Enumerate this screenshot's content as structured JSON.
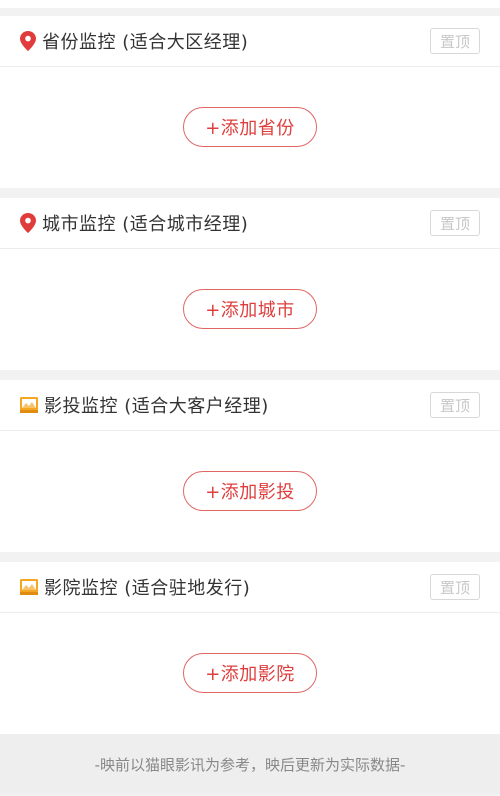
{
  "cards": [
    {
      "title": "省份监控 (适合大区经理)",
      "icon": "location-pin-icon",
      "top_label": "置顶",
      "add_label": "+添加省份"
    },
    {
      "title": "城市监控 (适合城市经理)",
      "icon": "location-pin-icon",
      "top_label": "置顶",
      "add_label": "+添加城市"
    },
    {
      "title": "影投监控 (适合大客户经理)",
      "icon": "cinema-icon",
      "top_label": "置顶",
      "add_label": "+添加影投"
    },
    {
      "title": "影院监控 (适合驻地发行)",
      "icon": "cinema-icon",
      "top_label": "置顶",
      "add_label": "+添加影院"
    }
  ],
  "footer": {
    "text": "-映前以猫眼影讯为参考，映后更新为实际数据-"
  },
  "colors": {
    "accent": "#df3e3e",
    "cinema_icon": "#f5a623",
    "border": "#ececec"
  }
}
